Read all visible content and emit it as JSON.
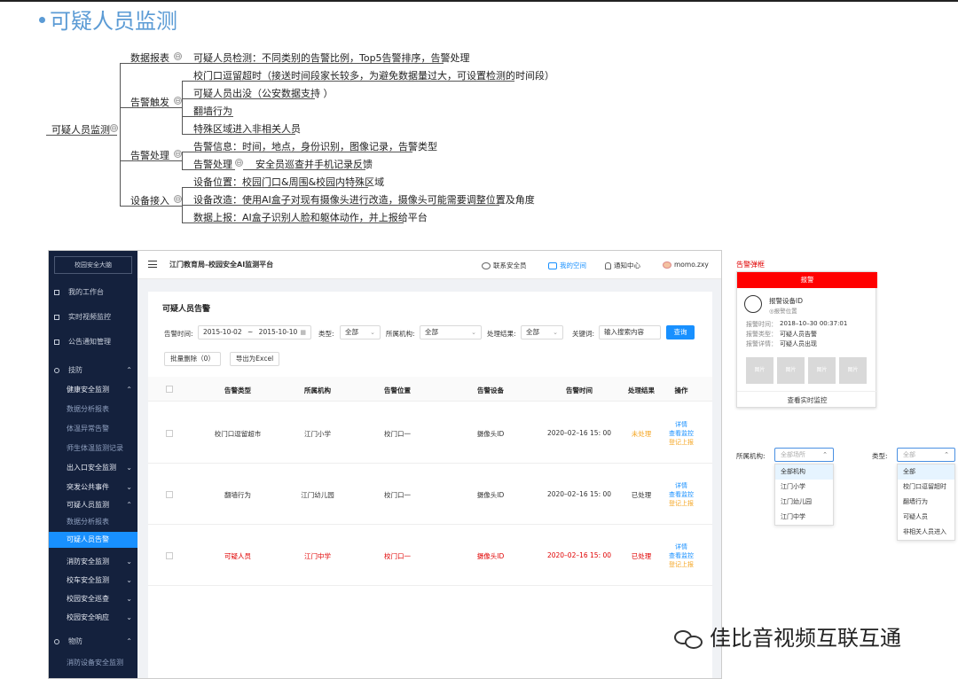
{
  "slide": {
    "title": "可疑人员监测"
  },
  "mindmap": {
    "root": "可疑人员监测",
    "b1": "数据报表",
    "b1_leaf": "可疑人员检测：不同类别的告警比例，Top5告警排序，告警处理",
    "b2": "告警触发",
    "b2_l1": "校门口逗留超时（接送时间段家长较多，为避免数据量过大，可设置检测的时间段）",
    "b2_l2": "可疑人员出没（公安数据支持 ）",
    "b2_l3": "翻墙行为",
    "b2_l4": "特殊区域进入非相关人员",
    "b3": "告警处理",
    "b3_l1": "告警信息：时间，地点，身份识别，图像记录，告警类型",
    "b3_l2": "告警处理",
    "b3_l2_child": "安全员巡查并手机记录反馈",
    "b4": "设备接入",
    "b4_l1": "设备位置：校园门口&周围&校园内特殊区域",
    "b4_l2": "设备改造：使用AI盒子对现有摄像头进行改造，摄像头可能需要调整位置及角度",
    "b4_l3": "数据上报：AI盒子识别人脸和躯体动作，并上报给平台",
    "collapse_symbol": "⊖"
  },
  "app": {
    "logo": "校园安全大脑",
    "header": {
      "title": "江门教育局–校园安全AI监测平台",
      "contact": "联系安全员",
      "myspace": "我的空间",
      "notify": "通知中心",
      "user": "momo.zxy"
    },
    "sidebar": {
      "workbench": "我的工作台",
      "video": "实时视频监控",
      "notice": "公告通知管理",
      "techdef": "技防",
      "health": "健康安全监测",
      "health_report": "数据分析报表",
      "temp_alarm": "体温异常告警",
      "staff_records": "师生体温监测记录",
      "entrance": "出入口安全监测",
      "emergency": "突发公共事件",
      "suspicious": "可疑人员监测",
      "susp_report": "数据分析报表",
      "susp_alarm": "可疑人员告警",
      "fire": "消防安全监测",
      "bus": "校车安全监测",
      "patrol": "校园安全巡查",
      "response": "校园安全响应",
      "physdef": "物防",
      "firedev": "消防设备安全监测",
      "arrow_up": "⌃",
      "arrow_down": "⌄"
    },
    "panel": {
      "title": "可疑人员告警",
      "time_label": "告警时间:",
      "date_from": "2015-10-02",
      "date_sep": "~",
      "date_to": "2015-10-10",
      "calendar_icon": "▦",
      "type_label": "类型:",
      "type_value": "全部",
      "org_label": "所属机构:",
      "org_value": "全部",
      "result_label": "处理结果:",
      "result_value": "全部",
      "keyword_label": "关键词:",
      "keyword_placeholder": "输入搜索内容",
      "search": "查询",
      "batch_delete": "批量删除（0）",
      "export": "导出为Excel",
      "caret": "⌄"
    },
    "table": {
      "columns": [
        "告警类型",
        "所属机构",
        "告警位置",
        "告警设备",
        "告警时间",
        "处理结果",
        "操作"
      ],
      "rows": [
        {
          "type": "校门口逗留超市",
          "org": "江门小学",
          "loc": "校门口一",
          "device": "摄像头ID",
          "time": "2020–02–16 15: 00",
          "result": "未处理"
        },
        {
          "type": "翻墙行为",
          "org": "江门幼儿园",
          "loc": "校门口一",
          "device": "摄像头ID",
          "time": "2020–02–16 15: 00",
          "result": "已处理"
        },
        {
          "type": "可疑人员",
          "org": "江门中学",
          "loc": "校门口一",
          "device": "摄像头ID",
          "time": "2020–02–16 15: 00",
          "result": "已处理"
        }
      ],
      "op_detail": "详情",
      "op_monitor": "查看监控",
      "op_report": "登记上报"
    }
  },
  "alarm_card": {
    "section_title": "告警弹框",
    "header": "报警",
    "device_id": "报警设备ID",
    "device_loc": "◎报警位置",
    "time_label": "报警时间：",
    "time_value": "2018–10–30  00:37:01",
    "type_label": "报警类型：",
    "type_value": "可疑人员告警",
    "detail_label": "报警详情：",
    "detail_value": "可疑人员出现",
    "thumb_label": "图片",
    "footer": "查看实时监控"
  },
  "dropdowns": {
    "org_label": "所属机构:",
    "org_placeholder": "全部场所",
    "org_options": [
      "全部机构",
      "江门小学",
      "江门幼儿园",
      "江门中学"
    ],
    "type_label": "类型:",
    "type_placeholder": "全部",
    "type_options": [
      "全部",
      "校门口逗留超时",
      "翻墙行为",
      "可疑人员",
      "非相关人员进入"
    ],
    "caret": "⌃"
  },
  "watermark": {
    "text": "佳比音视频互联互通"
  },
  "colors": {
    "accent": "#1890ff",
    "alert": "#ff0000",
    "warn": "#f5a623",
    "title_blue": "#5b9bd5",
    "sidebar": "#14213d"
  }
}
